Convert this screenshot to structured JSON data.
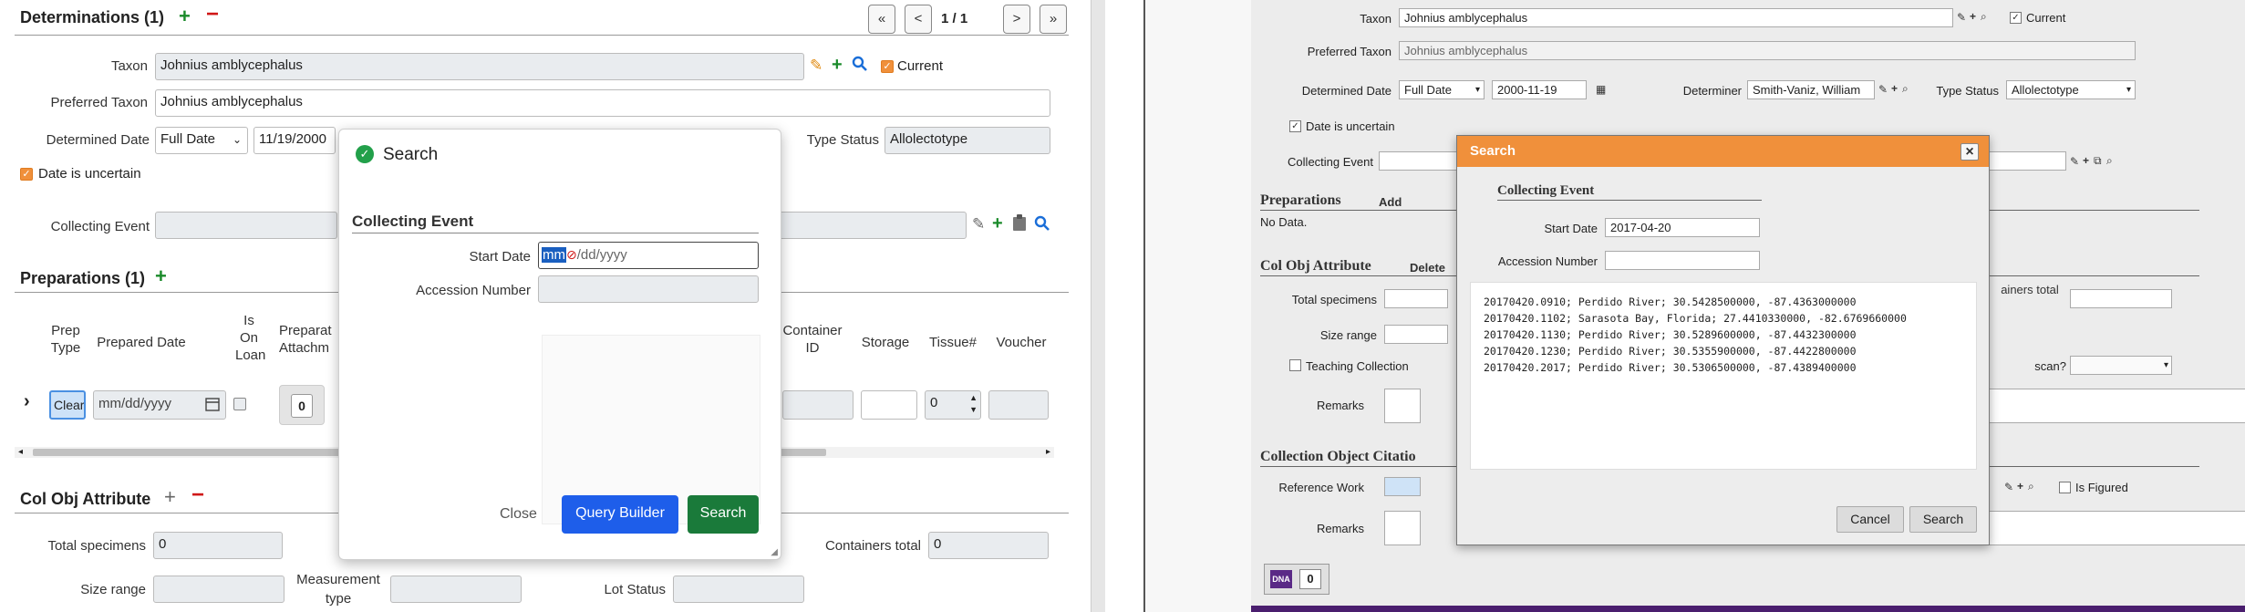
{
  "left": {
    "determinations": {
      "title": "Determinations (1)",
      "pager": {
        "first": "«",
        "prev": "<",
        "page": "1 / 1",
        "next": ">",
        "last": "»"
      },
      "taxon_label": "Taxon",
      "taxon_value": "Johnius amblycephalus",
      "current_label": "Current",
      "preferred_taxon_label": "Preferred Taxon",
      "preferred_taxon_value": "Johnius amblycephalus",
      "determined_date_label": "Determined Date",
      "date_precision": "Full Date",
      "date_value": "11/19/2000",
      "type_status_label": "Type Status",
      "type_status_value": "Allolectotype",
      "uncertain_label": "Date is uncertain",
      "collecting_event_label": "Collecting Event"
    },
    "preparations": {
      "title": "Preparations (1)",
      "col_prep_type": "Prep Type",
      "col_prepared_date": "Prepared Date",
      "col_on_loan": "Is On Loan",
      "col_attachments": "Preparat Attachm",
      "col_container_id": "Container ID",
      "col_storage": "Storage",
      "col_tissue": "Tissue#",
      "col_voucher": "Voucher",
      "prep_type_value": "Clear",
      "prepared_date_placeholder": "mm/dd/yyyy",
      "attachments_count": "0",
      "tissue_value": "0"
    },
    "col_obj_attribute": {
      "title": "Col Obj Attribute",
      "total_specimens_label": "Total specimens",
      "total_specimens_value": "0",
      "containers_total_label": "Containers total",
      "containers_total_value": "0",
      "size_range_label": "Size range",
      "measurement_type_label": "Measurement type",
      "lot_status_label": "Lot Status"
    },
    "search_modal": {
      "title": "Search",
      "section": "Collecting Event",
      "start_date_label": "Start Date",
      "start_date_sel": "mm",
      "start_date_rest": "/dd/yyyy",
      "accession_label": "Accession Number",
      "close_label": "Close",
      "query_builder_label": "Query Builder",
      "search_label": "Search"
    }
  },
  "right": {
    "taxon_label": "Taxon",
    "taxon_value": "Johnius amblycephalus",
    "current_label": "Current",
    "preferred_taxon_label": "Preferred Taxon",
    "preferred_taxon_value": "Johnius amblycephalus",
    "determined_date_label": "Determined Date",
    "date_precision": "Full Date",
    "date_value": "2000-11-19",
    "determiner_label": "Determiner",
    "determiner_value": "Smith-Vaniz, William",
    "type_status_label": "Type Status",
    "type_status_value": "Allolectotype",
    "uncertain_label": "Date is uncertain",
    "collecting_event_label": "Collecting Event",
    "preparations_title": "Preparations",
    "preparations_add": "Add",
    "preparations_empty": "No Data.",
    "col_obj_title": "Col Obj Attribute",
    "col_obj_delete": "Delete",
    "total_specimens_label": "Total specimens",
    "containers_total_label": "ainers total",
    "size_range_label": "Size range",
    "teaching_label": "Teaching Collection",
    "scan_label": "scan?",
    "remarks_label": "Remarks",
    "citation_title": "Collection Object Citatio",
    "reference_work_label": "Reference Work",
    "is_figured_label": "Is Figured",
    "remarks2_label": "Remarks",
    "dna_count": "0",
    "dna_label": "DNA",
    "search_modal": {
      "title": "Search",
      "close_icon": "×",
      "section": "Collecting Event",
      "start_date_label": "Start Date",
      "start_date_value": "2017-04-20",
      "accession_label": "Accession Number",
      "results": [
        "20170420.0910; Perdido River; 30.5428500000, -87.4363000000",
        "20170420.1102; Sarasota Bay, Florida; 27.4410330000, -82.6769660000",
        "20170420.1130; Perdido River; 30.5289600000, -87.4432300000",
        "20170420.1230; Perdido River; 30.5355900000, -87.4422800000",
        "20170420.2017; Perdido River; 30.5306500000, -87.4389400000"
      ],
      "cancel_label": "Cancel",
      "search_label": "Search"
    }
  }
}
